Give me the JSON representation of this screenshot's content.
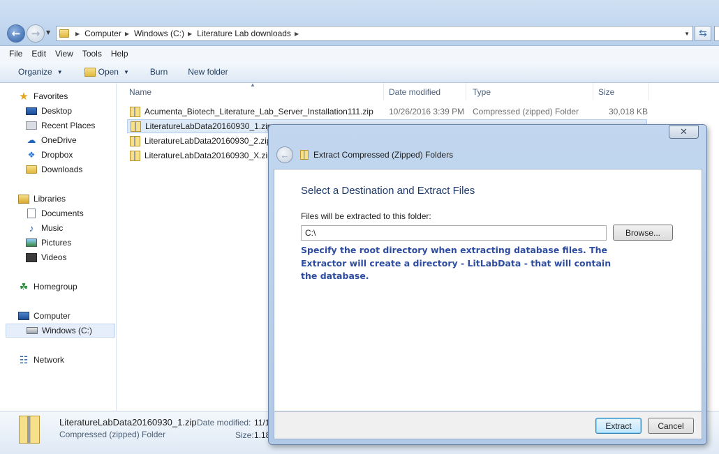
{
  "address_bar": {
    "crumbs": [
      "Computer",
      "Windows (C:)",
      "Literature Lab downloads"
    ]
  },
  "menu": [
    "File",
    "Edit",
    "View",
    "Tools",
    "Help"
  ],
  "toolbar": {
    "organize": "Organize",
    "open": "Open",
    "burn": "Burn",
    "new_folder": "New folder"
  },
  "nav": {
    "favorites": "Favorites",
    "favorites_items": [
      "Desktop",
      "Recent Places",
      "OneDrive",
      "Dropbox",
      "Downloads"
    ],
    "libraries": "Libraries",
    "libraries_items": [
      "Documents",
      "Music",
      "Pictures",
      "Videos"
    ],
    "homegroup": "Homegroup",
    "computer": "Computer",
    "computer_items": [
      "Windows (C:)"
    ],
    "network": "Network"
  },
  "columns": {
    "name": "Name",
    "date_modified": "Date modified",
    "type": "Type",
    "size": "Size"
  },
  "files": [
    {
      "name": "Acumenta_Biotech_Literature_Lab_Server_Installation111.zip",
      "date": "10/26/2016 3:39 PM",
      "type": "Compressed (zipped) Folder",
      "size": "30,018 KB"
    },
    {
      "name": "LiteratureLabData20160930_1.zip",
      "date": "",
      "type": "",
      "size": ""
    },
    {
      "name": "LiteratureLabData20160930_2.zip",
      "date": "",
      "type": "",
      "size": ""
    },
    {
      "name": "LiteratureLabData20160930_X.zip",
      "date": "",
      "type": "",
      "size": ""
    }
  ],
  "details": {
    "filename": "LiteratureLabData20160930_1.zip",
    "filetype": "Compressed (zipped) Folder",
    "date_label": "Date modified:",
    "date_value": "11/1",
    "size_label": "Size:",
    "size_value": "1.18"
  },
  "dialog": {
    "window_title": "Extract Compressed (Zipped) Folders",
    "heading": "Select a Destination and Extract Files",
    "path_label": "Files will be extracted to this folder:",
    "path_value": "C:\\",
    "browse_button": "Browse...",
    "note": "Specify the root directory when extracting database files. The Extractor will create a directory - LitLabData - that will contain the database.",
    "extract_button": "Extract",
    "cancel_button": "Cancel"
  }
}
